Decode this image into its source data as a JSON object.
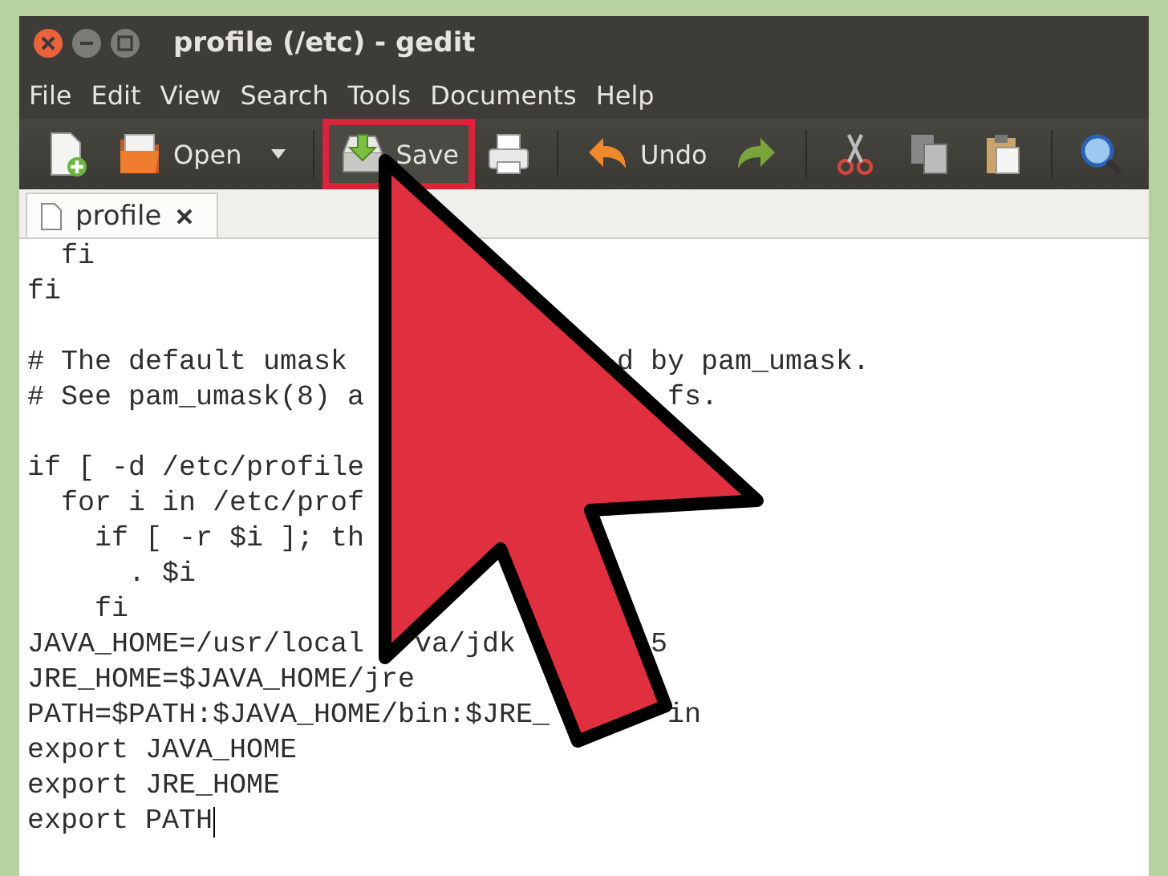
{
  "window": {
    "title": "profile (/etc) - gedit"
  },
  "menu": [
    "File",
    "Edit",
    "View",
    "Search",
    "Tools",
    "Documents",
    "Help"
  ],
  "toolbar": [
    {
      "kind": "new"
    },
    {
      "kind": "open",
      "label": "Open"
    },
    {
      "kind": "dropdown"
    },
    {
      "kind": "separator"
    },
    {
      "kind": "save",
      "label": "Save",
      "highlighted": true
    },
    {
      "kind": "print"
    },
    {
      "kind": "separator"
    },
    {
      "kind": "undo",
      "label": "Undo"
    },
    {
      "kind": "redo"
    },
    {
      "kind": "separator"
    },
    {
      "kind": "cut"
    },
    {
      "kind": "copy"
    },
    {
      "kind": "paste"
    },
    {
      "kind": "separator"
    },
    {
      "kind": "find"
    }
  ],
  "tabs": [
    {
      "label": "profile",
      "selected": true
    }
  ],
  "editor": {
    "lines": [
      {
        "kind": "code",
        "segments": [
          "  fi"
        ]
      },
      {
        "kind": "code",
        "segments": [
          "fi"
        ]
      },
      {
        "kind": "blank"
      },
      {
        "kind": "code",
        "segments": [
          "# The default umask",
          "d by pam_umask."
        ]
      },
      {
        "kind": "code",
        "segments": [
          "# See pam_umask(8) a",
          "fs."
        ]
      },
      {
        "kind": "blank"
      },
      {
        "kind": "code",
        "segments": [
          "if [ -d /etc/profile"
        ]
      },
      {
        "kind": "code",
        "segments": [
          "  for i in /etc/prof"
        ]
      },
      {
        "kind": "code",
        "segments": [
          "    if [ -r $i ]; th"
        ]
      },
      {
        "kind": "code",
        "segments": [
          "      . $i"
        ]
      },
      {
        "kind": "code",
        "segments": [
          "    fi"
        ]
      },
      {
        "kind": "code",
        "segments": [
          "JAVA_HOME=/usr/local",
          "va/jdk",
          "5"
        ]
      },
      {
        "kind": "code",
        "segments": [
          "JRE_HOME=$JAVA_HOME/jre"
        ]
      },
      {
        "kind": "code",
        "segments": [
          "PATH=$PATH:$JAVA_HOME/bin:$JRE_",
          "in"
        ]
      },
      {
        "kind": "code",
        "segments": [
          "export JAVA_HOME"
        ]
      },
      {
        "kind": "code",
        "segments": [
          "export JRE_HOME"
        ]
      },
      {
        "kind": "code",
        "segments": [
          "export PATH"
        ],
        "cursor": true
      }
    ]
  }
}
